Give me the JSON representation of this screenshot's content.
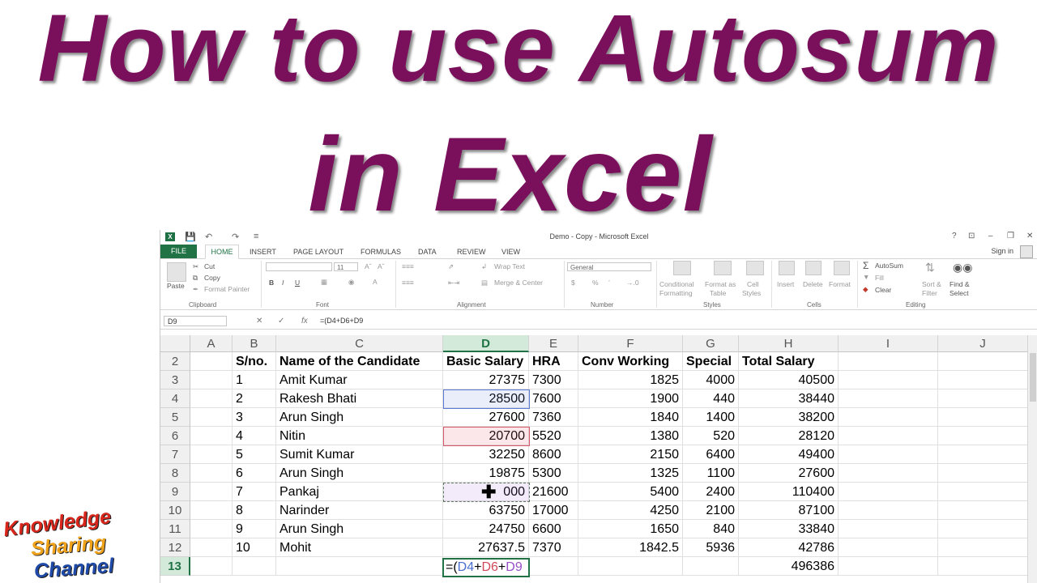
{
  "headline": {
    "line1": "How to use Autosum",
    "line2": "in Excel"
  },
  "logo": {
    "word1": "Knowledge",
    "word2": "Sharing",
    "word3": "Channel"
  },
  "window": {
    "title": "Demo - Copy - Microsoft Excel",
    "app_icon": "X",
    "quick_access": [
      "save-icon",
      "undo-icon",
      "redo-icon"
    ],
    "controls": [
      "?",
      "⊡",
      "–",
      "❐",
      "✕"
    ]
  },
  "tabs": [
    "FILE",
    "HOME",
    "INSERT",
    "PAGE LAYOUT",
    "FORMULAS",
    "DATA",
    "REVIEW",
    "VIEW"
  ],
  "signin": "Sign in",
  "ribbon": {
    "clipboard": {
      "paste": "Paste",
      "cut": "Cut",
      "copy": "Copy",
      "format_painter": "Format Painter",
      "label": "Clipboard"
    },
    "font": {
      "size": "11",
      "bold": "B",
      "italic": "I",
      "underline": "U",
      "label": "Font"
    },
    "alignment": {
      "wrap_text": "Wrap Text",
      "merge_center": "Merge & Center",
      "label": "Alignment"
    },
    "number": {
      "format": "General",
      "currency": "$",
      "percent": "%",
      "label": "Number"
    },
    "styles": {
      "conditional": "Conditional",
      "conditional2": "Formatting",
      "format_as": "Format as",
      "table": "Table",
      "cell": "Cell",
      "cell_styles": "Styles",
      "label": "Styles"
    },
    "cells": {
      "insert": "Insert",
      "delete": "Delete",
      "format": "Format",
      "label": "Cells"
    },
    "editing": {
      "autosum": "AutoSum",
      "fill": "Fill",
      "clear": "Clear",
      "sort": "Sort &",
      "filter": "Filter",
      "find": "Find &",
      "select": "Select",
      "label": "Editing"
    }
  },
  "formula_bar": {
    "name_box": "D9",
    "cancel": "✕",
    "enter": "✓",
    "fx": "fx",
    "formula": "=(D4+D6+D9"
  },
  "columns": [
    "A",
    "B",
    "C",
    "D",
    "E",
    "F",
    "G",
    "H",
    "I",
    "J"
  ],
  "rows": [
    {
      "num": "2",
      "B": "S/no.",
      "C": "Name of the Candidate",
      "D": "Basic Salary",
      "E": "HRA",
      "F": "Conv Working",
      "G": "Special",
      "H": "Total Salary"
    },
    {
      "num": "3",
      "B": "1",
      "C": "Amit Kumar",
      "D": "27375",
      "E": "7300",
      "F": "1825",
      "G": "4000",
      "H": "40500"
    },
    {
      "num": "4",
      "B": "2",
      "C": "Rakesh Bhati",
      "D": "28500",
      "E": "7600",
      "F": "1900",
      "G": "440",
      "H": "38440"
    },
    {
      "num": "5",
      "B": "3",
      "C": "Arun Singh",
      "D": "27600",
      "E": "7360",
      "F": "1840",
      "G": "1400",
      "H": "38200"
    },
    {
      "num": "6",
      "B": "4",
      "C": "Nitin",
      "D": "20700",
      "E": "5520",
      "F": "1380",
      "G": "520",
      "H": "28120"
    },
    {
      "num": "7",
      "B": "5",
      "C": "Sumit Kumar",
      "D": "32250",
      "E": "8600",
      "F": "2150",
      "G": "6400",
      "H": "49400"
    },
    {
      "num": "8",
      "B": "6",
      "C": "Arun Singh",
      "D": "19875",
      "E": "5300",
      "F": "1325",
      "G": "1100",
      "H": "27600"
    },
    {
      "num": "9",
      "B": "7",
      "C": "Pankaj",
      "D": "000",
      "E": "21600",
      "F": "5400",
      "G": "2400",
      "H": "110400"
    },
    {
      "num": "10",
      "B": "8",
      "C": "Narinder",
      "D": "63750",
      "E": "17000",
      "F": "4250",
      "G": "2100",
      "H": "87100"
    },
    {
      "num": "11",
      "B": "9",
      "C": "Arun Singh",
      "D": "24750",
      "E": "6600",
      "F": "1650",
      "G": "840",
      "H": "33840"
    },
    {
      "num": "12",
      "B": "10",
      "C": "Mohit",
      "D": "27637.5",
      "E": "7370",
      "F": "1842.5",
      "G": "5936",
      "H": "42786"
    },
    {
      "num": "13",
      "B": "",
      "C": "",
      "D": "",
      "E": "",
      "F": "",
      "G": "",
      "H": "496386"
    }
  ],
  "edit_formula": {
    "p1": "=(",
    "p2": "D4",
    "p3": "+",
    "p4": "D6",
    "p5": "+",
    "p6": "D9"
  },
  "colors": {
    "title": "#7a0f5c",
    "excel_green": "#217346"
  }
}
